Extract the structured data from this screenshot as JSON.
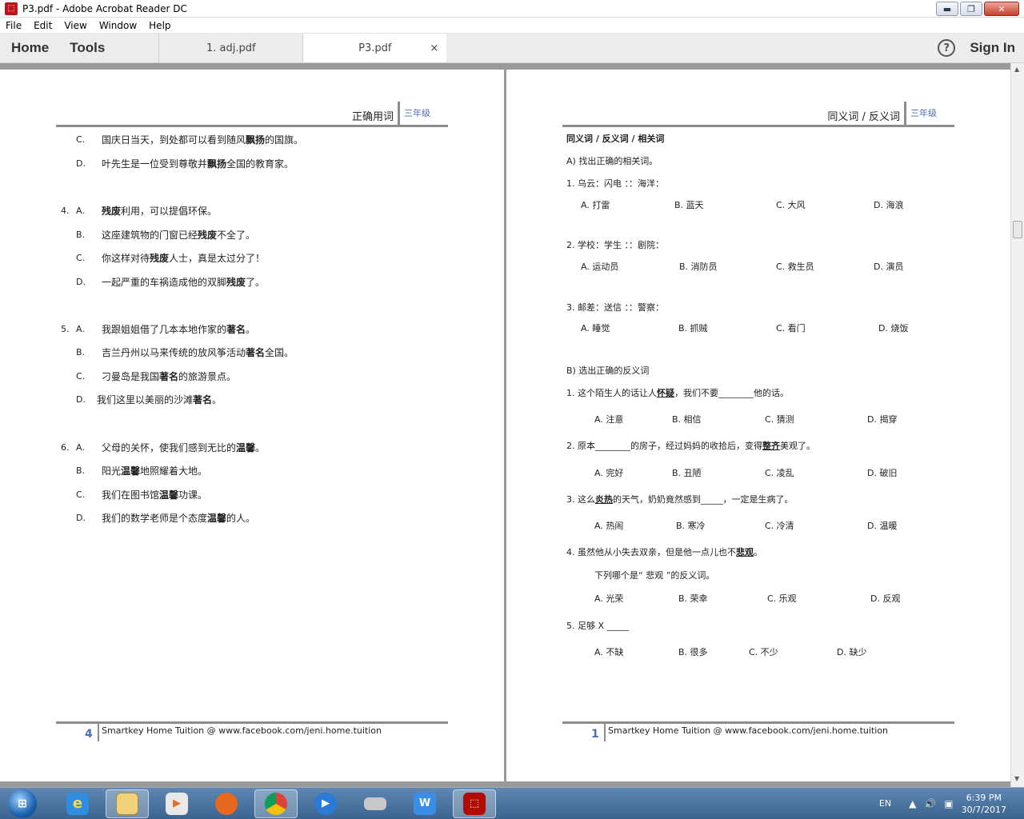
{
  "window": {
    "title": "P3.pdf - Adobe Acrobat Reader DC",
    "min": "▬",
    "max": "❐",
    "close": "✕"
  },
  "menu": [
    "File",
    "Edit",
    "View",
    "Window",
    "Help"
  ],
  "nav": {
    "home": "Home",
    "tools": "Tools",
    "help": "?",
    "sign_in": "Sign In"
  },
  "tabs": [
    {
      "label": "1. adj.pdf"
    },
    {
      "label": "P3.pdf",
      "close": "×"
    }
  ],
  "left_page": {
    "header_title": "正确用词",
    "grade": "三年级",
    "q3": {
      "c_label": "C.",
      "c_text": "国庆日当天，到处都可以看到随风",
      "c_bold": "飘扬",
      "c_tail": "的国旗。",
      "d_label": "D.",
      "d_text": "叶先生是一位受到尊敬并",
      "d_bold": "飘扬",
      "d_tail": "全国的教育家。"
    },
    "q4": {
      "num": "4.",
      "a_label": "A.",
      "a_bold": "残废",
      "a_tail": "利用，可以提倡环保。",
      "b_label": "B.",
      "b_text": "这座建筑物的门窗已经",
      "b_bold": "残废",
      "b_tail": "不全了。",
      "c_label": "C.",
      "c_text": "你这样对待",
      "c_bold": "残废",
      "c_tail": "人士，真是太过分了！",
      "d_label": "D.",
      "d_text": "一起严重的车祸造成他的双脚",
      "d_bold": "残废",
      "d_tail": "了。"
    },
    "q5": {
      "num": "5.",
      "a_label": "A.",
      "a_text": "我跟姐姐借了几本本地作家的",
      "a_bold": "著名",
      "a_tail": "。",
      "b_label": "B.",
      "b_text": "吉兰丹州以马来传统的放风筝活动",
      "b_bold": "著名",
      "b_tail": "全国。",
      "c_label": "C.",
      "c_text": "刁曼岛是我国",
      "c_bold": "著名",
      "c_tail": "的旅游景点。",
      "d_label": "D.",
      "d_text": "我们这里以美丽的沙滩",
      "d_bold": "著名",
      "d_tail": "。"
    },
    "q6": {
      "num": "6.",
      "a_label": "A.",
      "a_text": "父母的关怀，使我们感到无比的",
      "a_bold": "温馨",
      "a_tail": "。",
      "b_label": "B.",
      "b_text": "阳光",
      "b_bold": "温馨",
      "b_tail": "地照耀着大地。",
      "c_label": "C.",
      "c_text": "我们在图书馆",
      "c_bold": "温馨",
      "c_tail": "功课。",
      "d_label": "D.",
      "d_text": "我们的数学老师是个态度",
      "d_bold": "温馨",
      "d_tail": "的人。"
    },
    "footer_num": "4",
    "footer_text": "Smartkey Home Tuition @ www.facebook.com/jeni.home.tuition"
  },
  "right_page": {
    "header_title": "同义词 / 反义词",
    "grade": "三年级",
    "section_title": "同义词 / 反义词 / 相关词",
    "sec_a": "A) 找出正确的相关词。",
    "a_q1": "1. 乌云：闪电 ：：海洋：",
    "a_q1_opts": [
      "A. 打雷",
      "B. 蓝天",
      "C. 大风",
      "D. 海浪"
    ],
    "a_q2": "2. 学校：学生 ：：剧院：",
    "a_q2_opts": [
      "A. 运动员",
      "B. 消防员",
      "C. 救生员",
      "D. 演员"
    ],
    "a_q3": "3. 邮差：送信 ：：警察：",
    "a_q3_opts": [
      "A. 睡觉",
      "B. 抓贼",
      "C. 看门",
      "D. 烧饭"
    ],
    "sec_b": "B) 选出正确的反义词",
    "b_q1_pre": "1. 这个陌生人的话让人",
    "b_q1_ul": "怀疑",
    "b_q1_post": "，我们不要________他的话。",
    "b_q1_opts": [
      "A. 注意",
      "B. 相信",
      "C. 猜测",
      "D. 揭穿"
    ],
    "b_q2_pre": "2. 原本________的房子，经过妈妈的收拾后，变得",
    "b_q2_ul": "整齐",
    "b_q2_post": "美观了。",
    "b_q2_opts": [
      "A. 完好",
      "B. 丑陋",
      "C. 凌乱",
      "D. 破旧"
    ],
    "b_q3_pre": "3. 这么",
    "b_q3_ul": "炎热",
    "b_q3_post": "的天气，奶奶竟然感到_____，一定是生病了。",
    "b_q3_opts": [
      "A. 热闹",
      "B. 寒冷",
      "C. 冷清",
      "D. 温暖"
    ],
    "b_q4_pre": "4. 虽然他从小失去双亲，但是他一点儿也不",
    "b_q4_ul": "悲观",
    "b_q4_post": "。",
    "b_q4_sub": "下列哪个是“ 悲观 ”的反义词。",
    "b_q4_opts": [
      "A. 光荣",
      "B. 荣幸",
      "C. 乐观",
      "D. 反观"
    ],
    "b_q5": "5. 足够 X _____",
    "b_q5_opts": [
      "A. 不缺",
      "B. 很多",
      "C. 不少",
      "D. 缺少"
    ],
    "footer_num": "1",
    "footer_text": "Smartkey Home Tuition @ www.facebook.com/jeni.home.tuition"
  },
  "taskbar": {
    "lang": "EN",
    "time": "6:39 PM",
    "date": "30/7/2017",
    "tray_arrow": "▲",
    "speaker": "🔊",
    "network": "▣"
  }
}
